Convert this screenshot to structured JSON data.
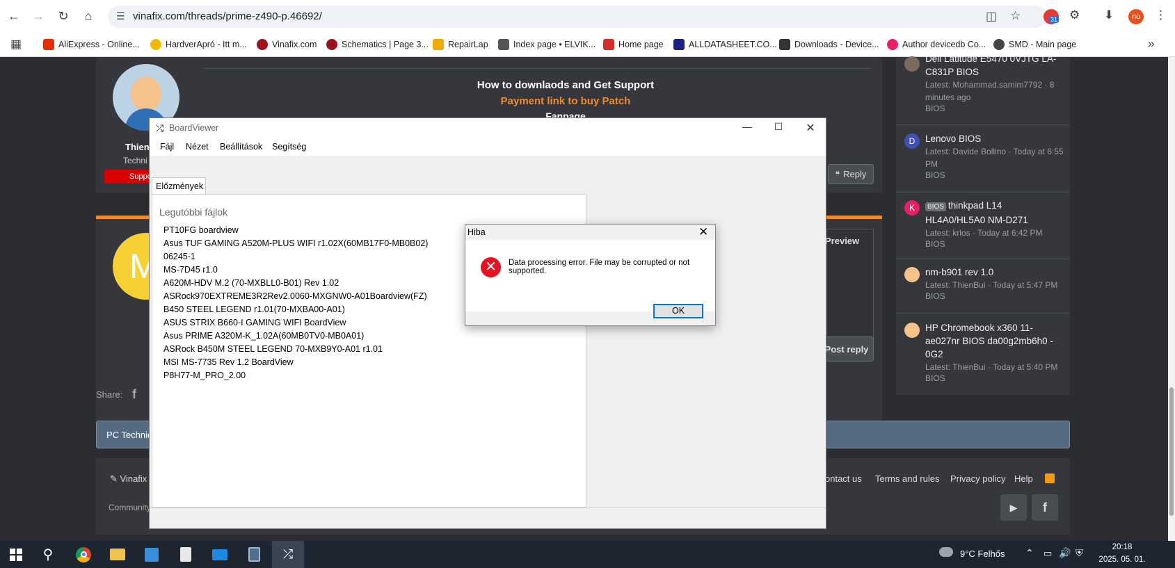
{
  "browser": {
    "url": "vinafix.com/threads/prime-z490-p.46692/",
    "calendar_badge": "31",
    "profile": "no",
    "bookmarks": [
      {
        "label": "AliExpress - Online...",
        "color": "#e62e04"
      },
      {
        "label": "HardverApró - Itt m...",
        "color": "#f5b700"
      },
      {
        "label": "Vinafix.com",
        "color": "#9b111e"
      },
      {
        "label": "Schematics | Page 3...",
        "color": "#9b111e"
      },
      {
        "label": "RepairLap",
        "color": "#f2a900"
      },
      {
        "label": "Index page • ELVIK...",
        "color": "#555555"
      },
      {
        "label": "Home page",
        "color": "#d32f2f"
      },
      {
        "label": "ALLDATASHEET.CO...",
        "color": "#1a237e"
      },
      {
        "label": "Downloads - Device...",
        "color": "#333333"
      },
      {
        "label": "Author devicedb Co...",
        "color": "#e91e63"
      },
      {
        "label": "SMD - Main page",
        "color": "#444444"
      }
    ]
  },
  "forum": {
    "signature_line1": "How to downlaods and Get Support",
    "signature_line2": "Payment link to buy Patch",
    "signature_line3": "Fanpage",
    "user_name": "Thien",
    "user_title": "Techni",
    "user_badge": "Suppo",
    "reply_label": "Reply",
    "preview_label": "Preview",
    "post_reply_label": "Post reply",
    "share_label": "Share:",
    "breadcrumb": "PC Technic",
    "footer_brand": "Vinafix",
    "footer_links": [
      "ontact us",
      "Terms and rules",
      "Privacy policy",
      "Help"
    ],
    "footer_community": "Community",
    "sidebar": [
      {
        "title": "Dell Latitude E5470 0VJTG LA-C831P BIOS",
        "meta": "Latest: Mohammad.samim7792 · 8 minutes ago",
        "tag": "BIOS",
        "avatar": "",
        "avatar_color": "#7a6b5d"
      },
      {
        "title": "Lenovo BIOS",
        "meta": "Latest: Davide Bollino · Today at 6:55 PM",
        "tag": "BIOS",
        "avatar": "D",
        "avatar_color": "#3f51b5"
      },
      {
        "title": "thinkpad L14 HL4A0/HL5A0 NM-D271",
        "prefix": "BIOS",
        "meta": "Latest: krlos · Today at 6:42 PM",
        "tag": "BIOS",
        "avatar": "K",
        "avatar_color": "#e91e63"
      },
      {
        "title": "nm-b901 rev 1.0",
        "meta": "Latest: ThienBui · Today at 5:47 PM",
        "tag": "BIOS",
        "avatar": "",
        "avatar_color": "#2b2d31"
      },
      {
        "title": "HP Chromebook x360 11-ae027nr BIOS da00g2mb6h0 - 0G2",
        "meta": "Latest: ThienBui · Today at 5:40 PM",
        "tag": "BIOS",
        "avatar": "",
        "avatar_color": "#2b2d31"
      }
    ]
  },
  "boardviewer": {
    "title": "BoardViewer",
    "menu": [
      "Fájl",
      "Nézet",
      "Beállítások",
      "Segítség"
    ],
    "tab": "Előzmények",
    "heading": "Legutóbbi fájlok",
    "files": [
      "PT10FG boardview",
      "Asus TUF GAMING A520M-PLUS WIFI r1.02X(60MB17F0-MB0B02)",
      "06245-1",
      "MS-7D45 r1.0",
      "A620M-HDV M.2 (70-MXBLL0-B01) Rev 1.02",
      "ASRock970EXTREME3R2Rev2.0060-MXGNW0-A01Boardview(FZ)",
      "B450 STEEL LEGEND r1.01(70-MXBA00-A01)",
      "ASUS STRIX B660-I GAMING WIFI BoardView",
      "Asus PRIME A320M-K_1.02A(60MB0TV0-MB0A01)",
      "ASRock B450M STEEL LEGEND 70-MXB9Y0-A01 r1.01",
      "MSI MS-7735 Rev 1.2 BoardView",
      "P8H77-M_PRO_2.00"
    ]
  },
  "dialog": {
    "title": "Hiba",
    "message": "Data processing error. File may be corrupted or not supported.",
    "ok_label": "OK"
  },
  "taskbar": {
    "weather": "9°C  Felhős",
    "time": "20:18",
    "date": "2025. 05. 01."
  }
}
